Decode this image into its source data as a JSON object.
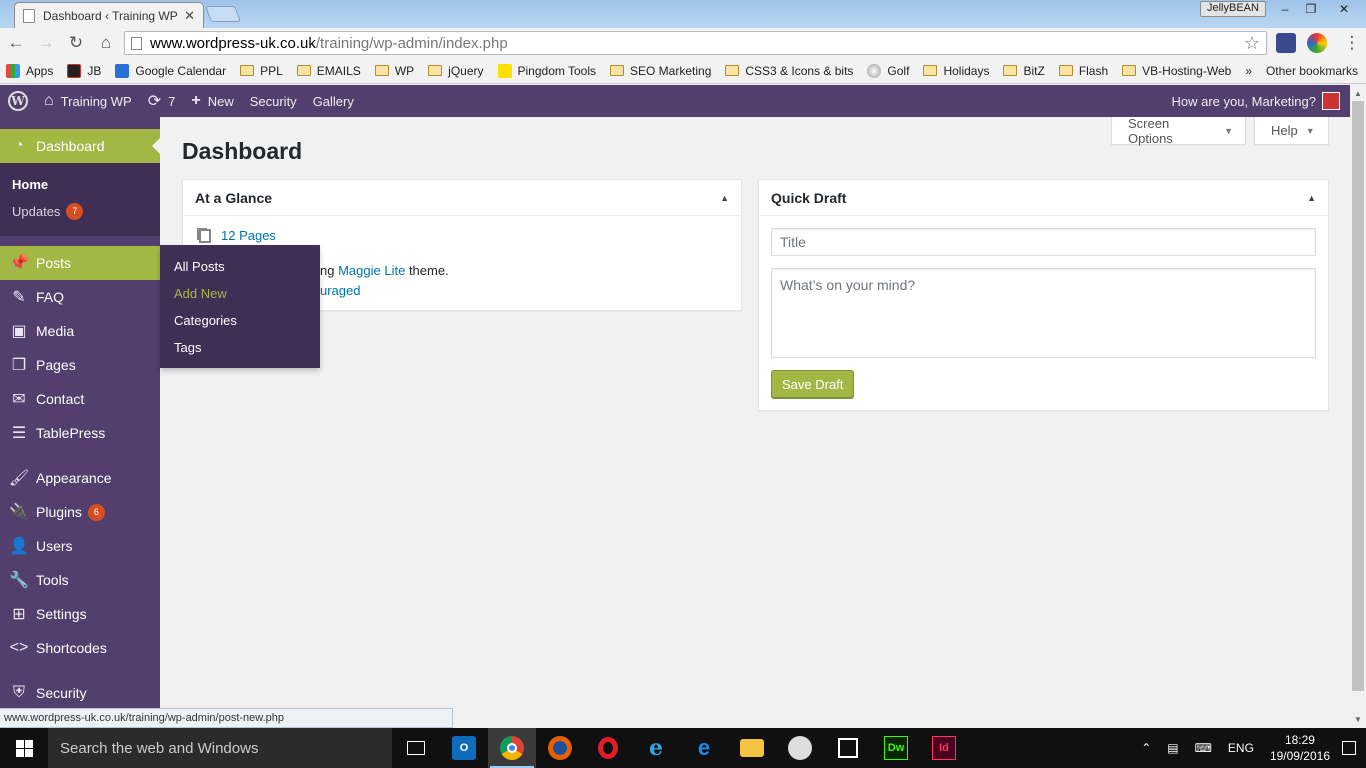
{
  "browser": {
    "tab_title": "Dashboard ‹ Training WP",
    "profile_name": "JellyBEAN",
    "url_host": "www.wordpress-uk.co.uk",
    "url_path": "/training/wp-admin/index.php",
    "bookmarks": [
      "Apps",
      "JB",
      "Google Calendar",
      "PPL",
      "EMAILS",
      "WP",
      "jQuery",
      "Pingdom Tools",
      "SEO Marketing",
      "CSS3 & Icons & bits",
      "Golf",
      "Holidays",
      "BitZ",
      "Flash",
      "VB-Hosting-Web"
    ],
    "bookmarks_more": "»",
    "other_bookmarks": "Other bookmarks",
    "status_url": "www.wordpress-uk.co.uk/training/wp-admin/post-new.php"
  },
  "adminbar": {
    "site_name": "Training WP",
    "updates_count": "7",
    "new_label": "New",
    "security_label": "Security",
    "gallery_label": "Gallery",
    "greeting": "How are you, Marketing?"
  },
  "sidebar": {
    "dashboard": "Dashboard",
    "home": "Home",
    "updates": "Updates",
    "updates_badge": "7",
    "items": [
      "Posts",
      "FAQ",
      "Media",
      "Pages",
      "Contact",
      "TablePress",
      "Appearance",
      "Plugins",
      "Users",
      "Tools",
      "Settings",
      "Shortcodes",
      "Security"
    ],
    "plugins_badge": "6"
  },
  "flyout": {
    "items": [
      "All Posts",
      "Add New",
      "Categories",
      "Tags"
    ]
  },
  "main": {
    "title": "Dashboard",
    "screen_options": "Screen Options",
    "help": "Help"
  },
  "at_a_glance": {
    "title": "At a Glance",
    "pages_link": "12 Pages",
    "theme_prefix": "ng",
    "theme_link": "Maggie Lite",
    "theme_suffix": "theme.",
    "discouraged_fragment": "uraged"
  },
  "quick_draft": {
    "title": "Quick Draft",
    "title_placeholder": "Title",
    "content_placeholder": "What’s on your mind?",
    "save_label": "Save Draft"
  },
  "taskbar": {
    "search_placeholder": "Search the web and Windows",
    "lang": "ENG",
    "time": "18:29",
    "date": "19/09/2016"
  },
  "colors": {
    "admin_purple": "#523f6d",
    "submenu_purple": "#3f2f55",
    "accent_green": "#a3b745",
    "link_blue": "#0073aa",
    "badge_orange": "#d54e21"
  }
}
